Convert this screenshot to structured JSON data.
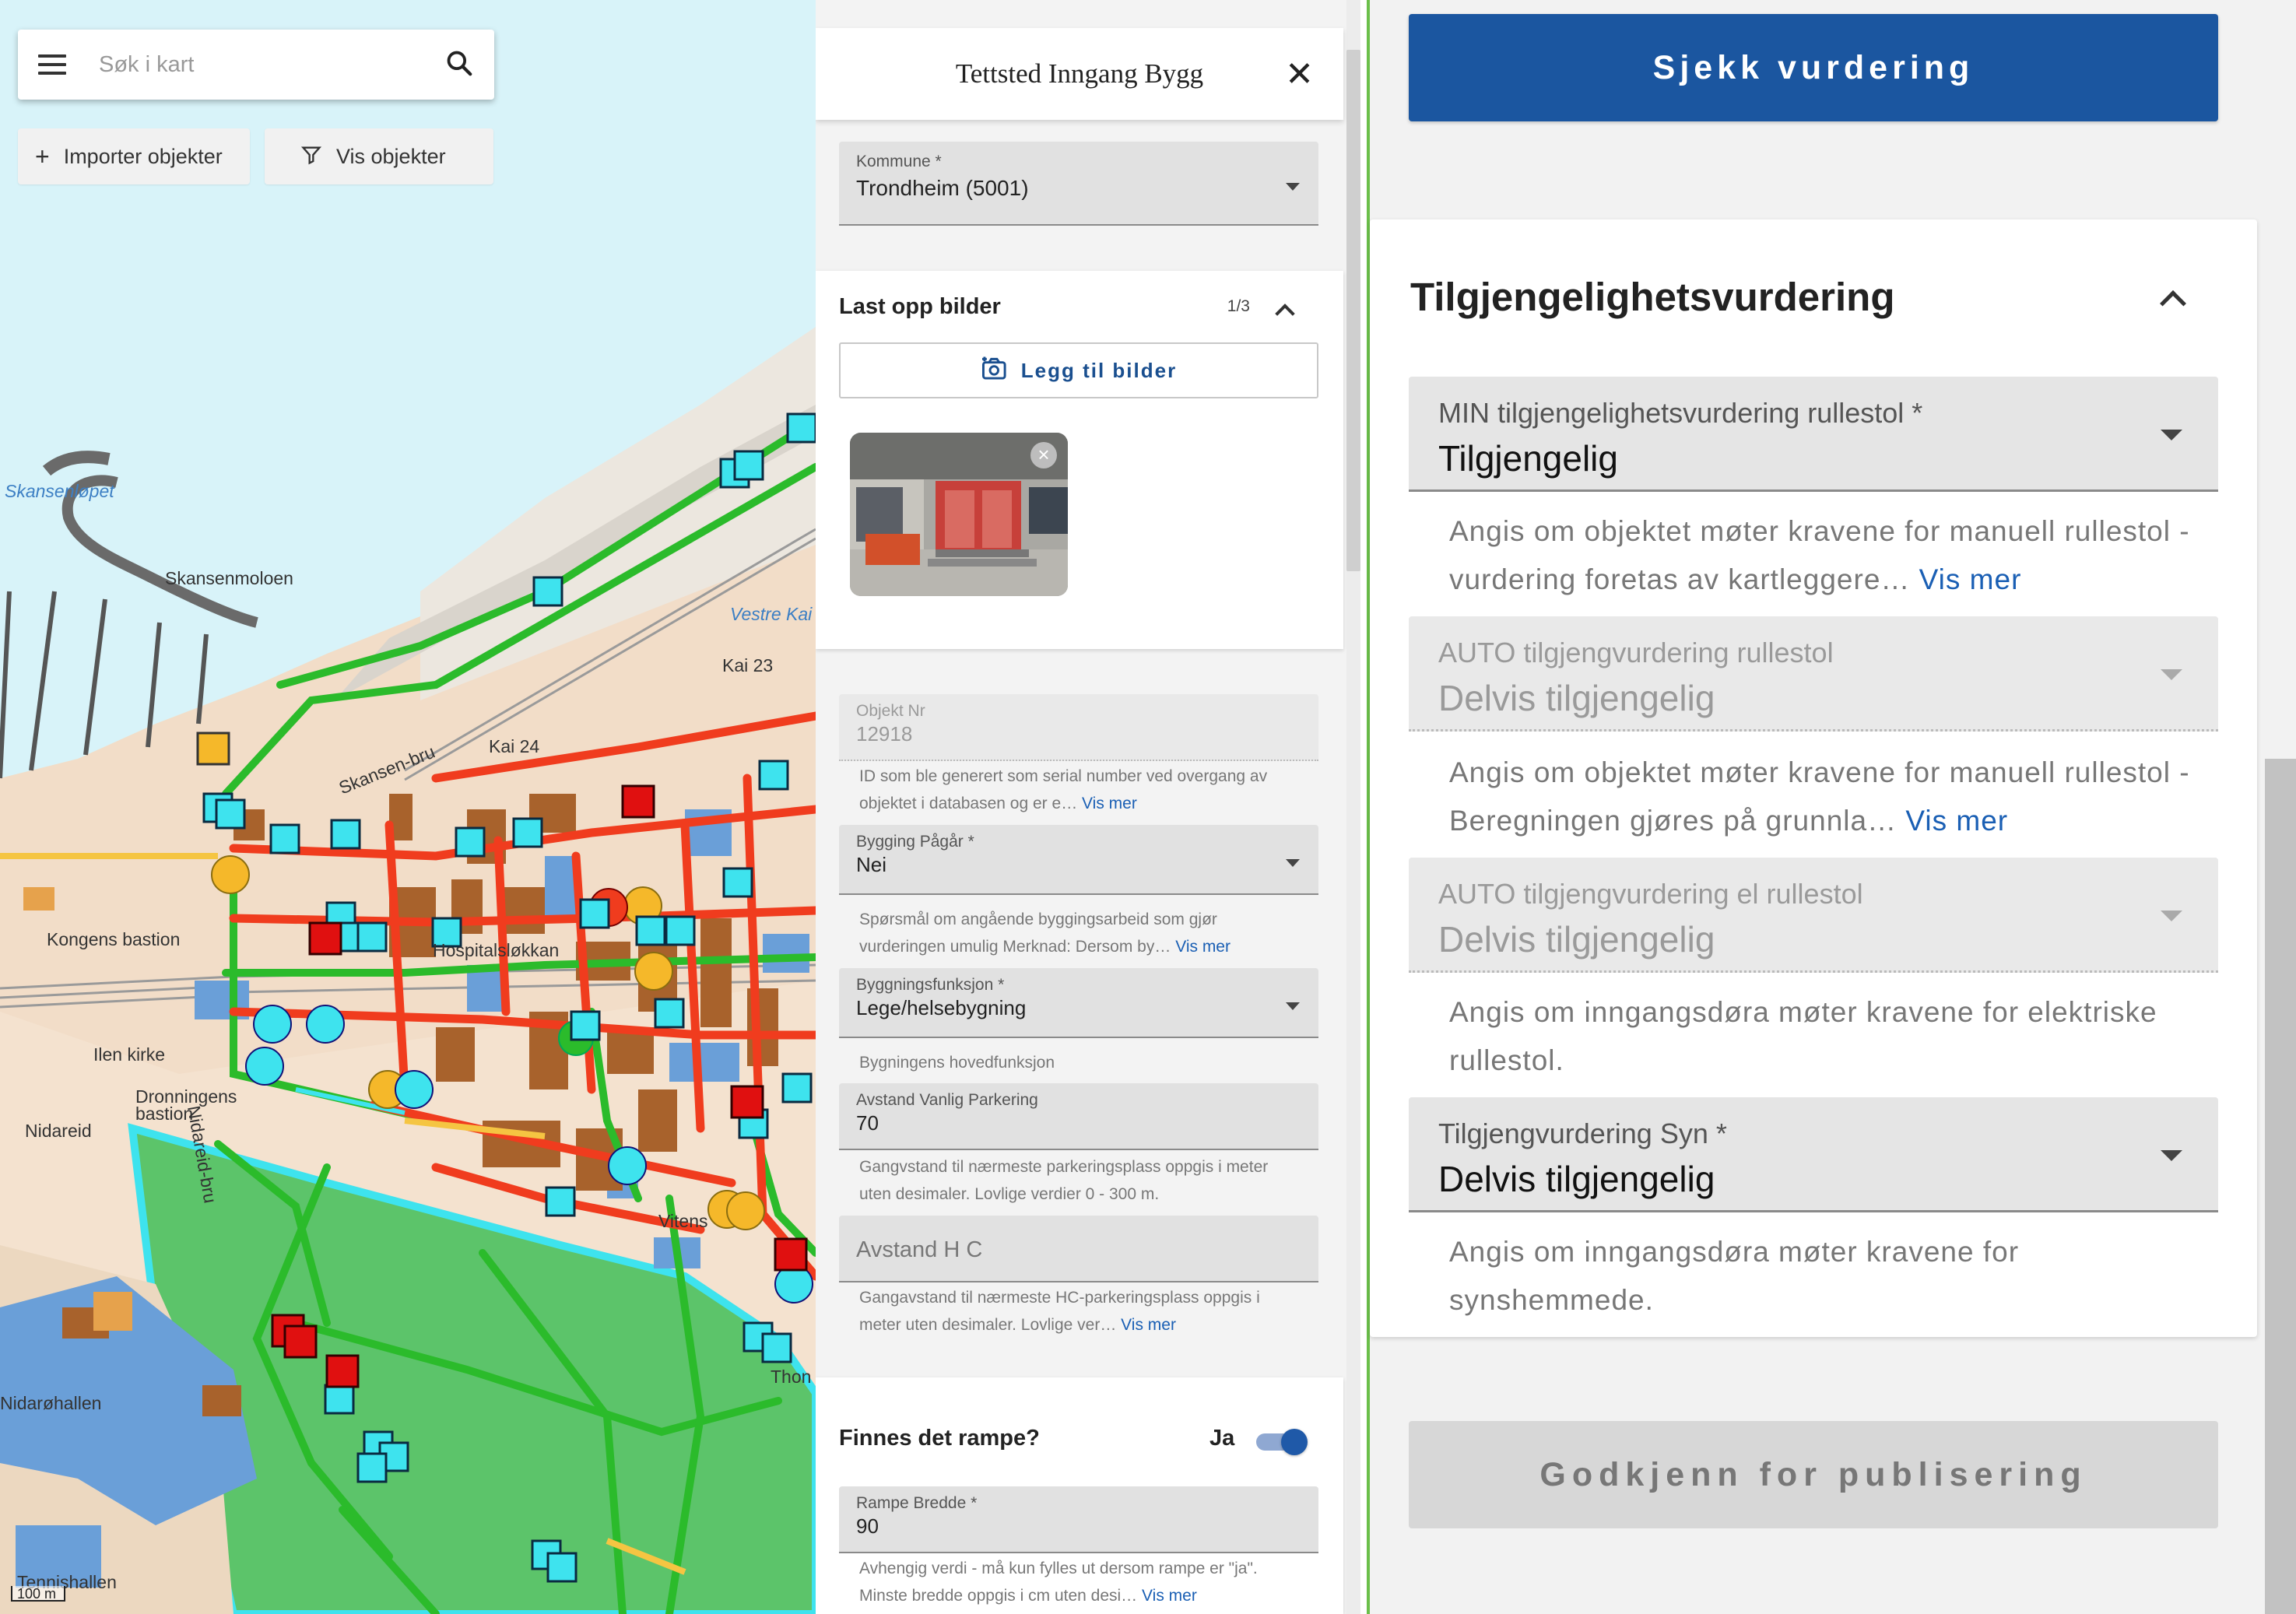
{
  "map": {
    "search_placeholder": "Søk i kart",
    "import_label": "Importer objekter",
    "show_label": "Vis objekter",
    "scale_label": "100 m",
    "place_labels": {
      "skansenlopet": "Skansenløpet",
      "skansenmoloen": "Skansenmoloen",
      "vestre_kai": "Vestre Kai",
      "kai23": "Kai 23",
      "kai24": "Kai 24",
      "skansen_bru": "Skansen-bru",
      "kongens_bastion": "Kongens bastion",
      "ilen_kirke": "Ilen kirke",
      "dronningens_bastion": "Dronningens\nbastion",
      "nidareid": "Nidareid",
      "nidareid_bru": "Nidareid-bru",
      "nidarohallen": "Nidarøhallen",
      "tennishallen": "Tennishallen",
      "hospitalslokkan": "Hospitalsløkkan",
      "vitensenteret": "Vitens",
      "tho": "Thon"
    }
  },
  "panel": {
    "title": "Tettsted Inngang Bygg",
    "kommune": {
      "label": "Kommune *",
      "value": "Trondheim  (5001)"
    },
    "upload": {
      "title": "Last opp bilder",
      "count": "1/3",
      "button": "Legg til bilder"
    },
    "objekt_nr": {
      "label": "Objekt Nr",
      "value": "12918",
      "hint": "ID som ble generert som serial number ved overgang av objektet i databasen og er e…",
      "more": "Vis mer"
    },
    "bygging_pagar": {
      "label": "Bygging Pågår *",
      "value": "Nei",
      "hint": "Spørsmål om angående byggingsarbeid som gjør vurderingen umulig Merknad: Dersom by…",
      "more": "Vis mer"
    },
    "byggningsfunksjon": {
      "label": "Byggningsfunksjon *",
      "value": "Lege/helsebygning",
      "hint": "Bygningens hovedfunksjon"
    },
    "avstand_parkering": {
      "label": "Avstand Vanlig Parkering",
      "value": "70",
      "hint": "Gangvstand til nærmeste parkeringsplass oppgis i meter uten desimaler. Lovlige verdier 0 - 300 m."
    },
    "avstand_hc": {
      "placeholder": "Avstand H C",
      "hint": "Gangavstand til nærmeste HC-parkeringsplass oppgis i meter uten desimaler. Lovlige ver…",
      "more": "Vis mer"
    },
    "rampe": {
      "question": "Finnes det rampe?",
      "answer": "Ja"
    },
    "rampe_bredde": {
      "label": "Rampe Bredde *",
      "value": "90",
      "hint": "Avhengig verdi - må kun fylles ut dersom rampe er \"ja\". Minste bredde oppgis i cm uten desi…",
      "more": "Vis mer"
    }
  },
  "assessment": {
    "check_button": "Sjekk vurdering",
    "title": "Tilgjengelighetsvurdering",
    "fields": [
      {
        "label": "MIN tilgjengelighetsvurdering rullestol *",
        "value": "Tilgjengelig",
        "hint": "Angis om objektet møter kravene for manuell rullestol - vurdering foretas av kartleggere…",
        "more": "Vis mer"
      },
      {
        "label": "AUTO tilgjengvurdering rullestol",
        "value": "Delvis tilgjengelig",
        "hint": "Angis om objektet møter kravene for manuell rullestol - Beregningen gjøres på grunnla…",
        "more": "Vis mer"
      },
      {
        "label": "AUTO tilgjengvurdering el rullestol",
        "value": "Delvis tilgjengelig",
        "hint": "Angis om inngangsdøra møter kravene for elektriske rullestol.",
        "more": ""
      },
      {
        "label": "Tilgjengvurdering Syn *",
        "value": "Delvis tilgjengelig",
        "hint": "Angis om inngangsdøra møter kravene for synshemmede.",
        "more": ""
      }
    ],
    "publish_button": "Godkjenn for publisering"
  },
  "colors": {
    "primary": "#1b56a0",
    "path_green": "#2bbb2b",
    "path_red": "#f03c1e",
    "marker_cyan": "#3ee3ee",
    "marker_yellow": "#f5b82a",
    "marker_red": "#e01010",
    "water": "#d8f3f9",
    "park": "#5cc46a"
  }
}
